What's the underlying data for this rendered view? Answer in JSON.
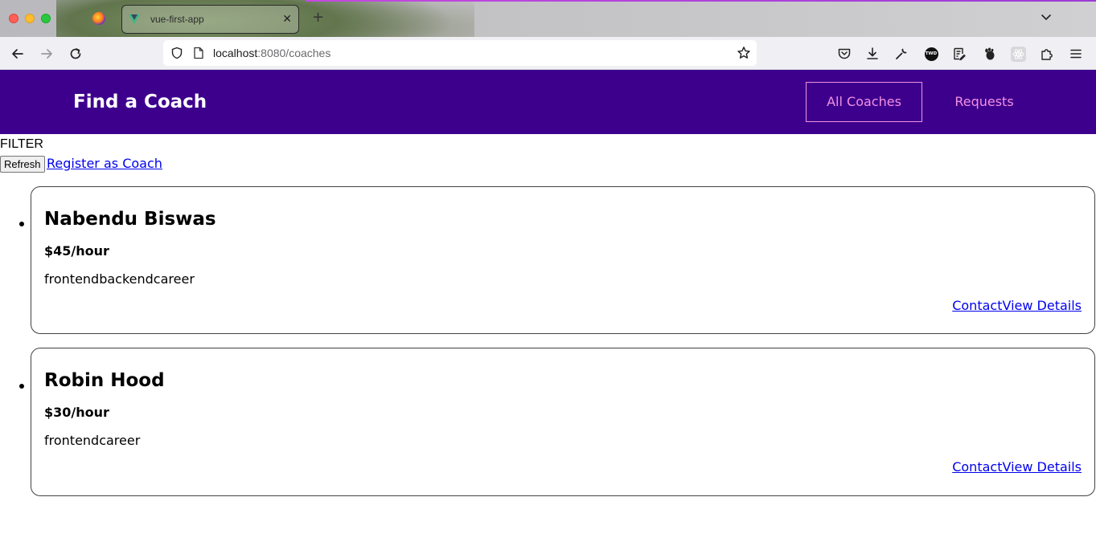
{
  "browser": {
    "tab_title": "vue-first-app",
    "tab_close": "✕",
    "new_tab": "+",
    "url_host": "localhost",
    "url_rest": ":8080/coaches",
    "extension_badge": "TWD",
    "icons": [
      "firefox-logo",
      "vue-logo",
      "back-arrow",
      "forward-arrow",
      "reload",
      "shield",
      "page",
      "bookmark-star",
      "pocket",
      "download",
      "wrench",
      "twd-extension",
      "reader-list",
      "gnome-extension",
      "react-devtools",
      "extensions-puzzle",
      "hamburger-menu",
      "chevron-down"
    ]
  },
  "header": {
    "brand": "Find a Coach",
    "nav": [
      {
        "label": "All Coaches",
        "active": true
      },
      {
        "label": "Requests",
        "active": false
      }
    ],
    "colors": {
      "background": "#3d008d",
      "link": "#f391e3"
    }
  },
  "filter": {
    "label": "FILTER",
    "refresh_label": "Refresh",
    "register_label": "Register as Coach"
  },
  "coaches": [
    {
      "name": "Nabendu Biswas",
      "rate": "$45/hour",
      "areas": "frontendbackendcareer",
      "contact_label": "Contact",
      "details_label": "View Details"
    },
    {
      "name": "Robin Hood",
      "rate": "$30/hour",
      "areas": "frontendcareer",
      "contact_label": "Contact",
      "details_label": "View Details"
    }
  ]
}
